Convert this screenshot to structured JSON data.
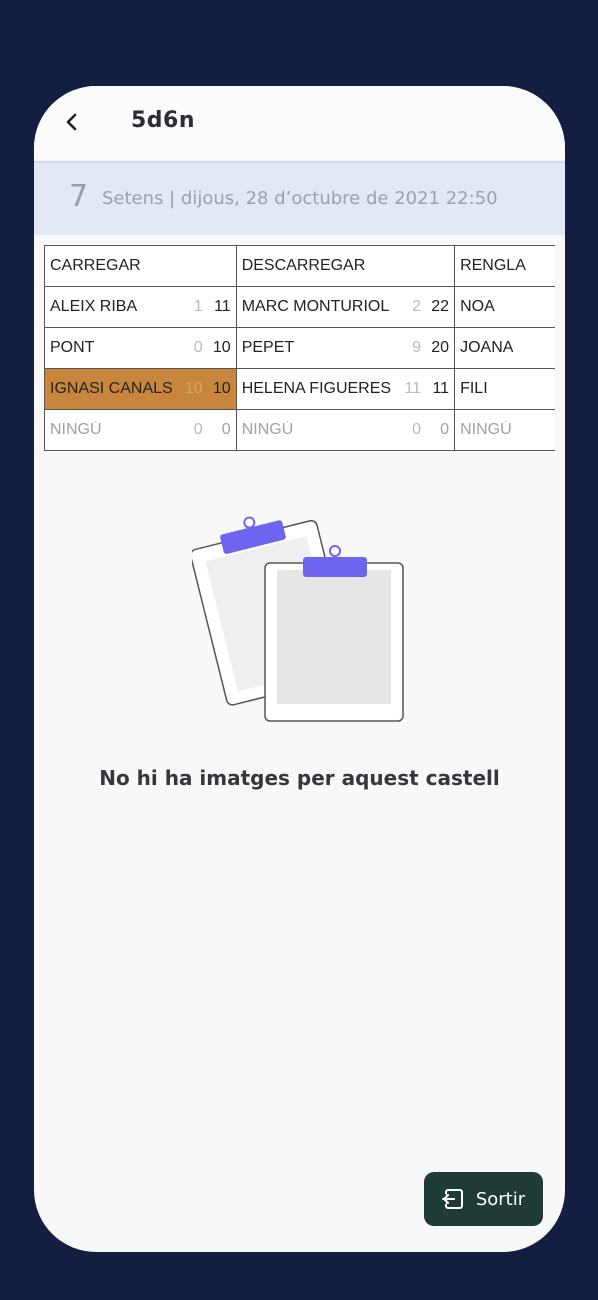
{
  "header": {
    "title": "5d6n",
    "back_icon": "chevron-left-icon"
  },
  "attempt": {
    "number": "7",
    "description": "Setens | dijous, 28 d’octubre de 2021 22:50"
  },
  "positions_table": {
    "columns": [
      {
        "header": "CARREGAR",
        "rows": [
          {
            "name": "ALEIX RIBA",
            "n1": "1",
            "n2": "11",
            "highlight": false,
            "empty": false
          },
          {
            "name": "PONT",
            "n1": "0",
            "n2": "10",
            "highlight": false,
            "empty": false
          },
          {
            "name": "IGNASI CANALS",
            "n1": "10",
            "n2": "10",
            "highlight": true,
            "empty": false
          },
          {
            "name": "NINGÚ",
            "n1": "0",
            "n2": "0",
            "highlight": false,
            "empty": true
          }
        ]
      },
      {
        "header": "DESCARREGAR",
        "rows": [
          {
            "name": "MARC MONTURIOL",
            "n1": "2",
            "n2": "22",
            "highlight": false,
            "empty": false
          },
          {
            "name": "PEPET",
            "n1": "9",
            "n2": "20",
            "highlight": false,
            "empty": false
          },
          {
            "name": "HELENA FIGUERES",
            "n1": "11",
            "n2": "11",
            "highlight": false,
            "empty": false
          },
          {
            "name": "NINGÚ",
            "n1": "0",
            "n2": "0",
            "highlight": false,
            "empty": true
          }
        ]
      },
      {
        "header": "RENGLA",
        "rows": [
          {
            "name": "NOA",
            "n1": "",
            "n2": "",
            "highlight": false,
            "empty": false
          },
          {
            "name": "JOANA",
            "n1": "",
            "n2": "",
            "highlight": false,
            "empty": false
          },
          {
            "name": "FILI",
            "n1": "",
            "n2": "",
            "highlight": false,
            "empty": false
          },
          {
            "name": "NINGÚ",
            "n1": "",
            "n2": "",
            "highlight": false,
            "empty": true
          }
        ]
      }
    ]
  },
  "empty_state": {
    "icon": "clipboard-illustration-icon",
    "message": "No hi ha imatges per aquest castell"
  },
  "exit_button": {
    "label": "Sortir",
    "icon": "exit-icon",
    "color": "#1f3b37"
  },
  "colors": {
    "background": "#141e40",
    "highlight": "#c8863d",
    "banner": "#e2e8f4",
    "accent_clip": "#6e64f0"
  }
}
